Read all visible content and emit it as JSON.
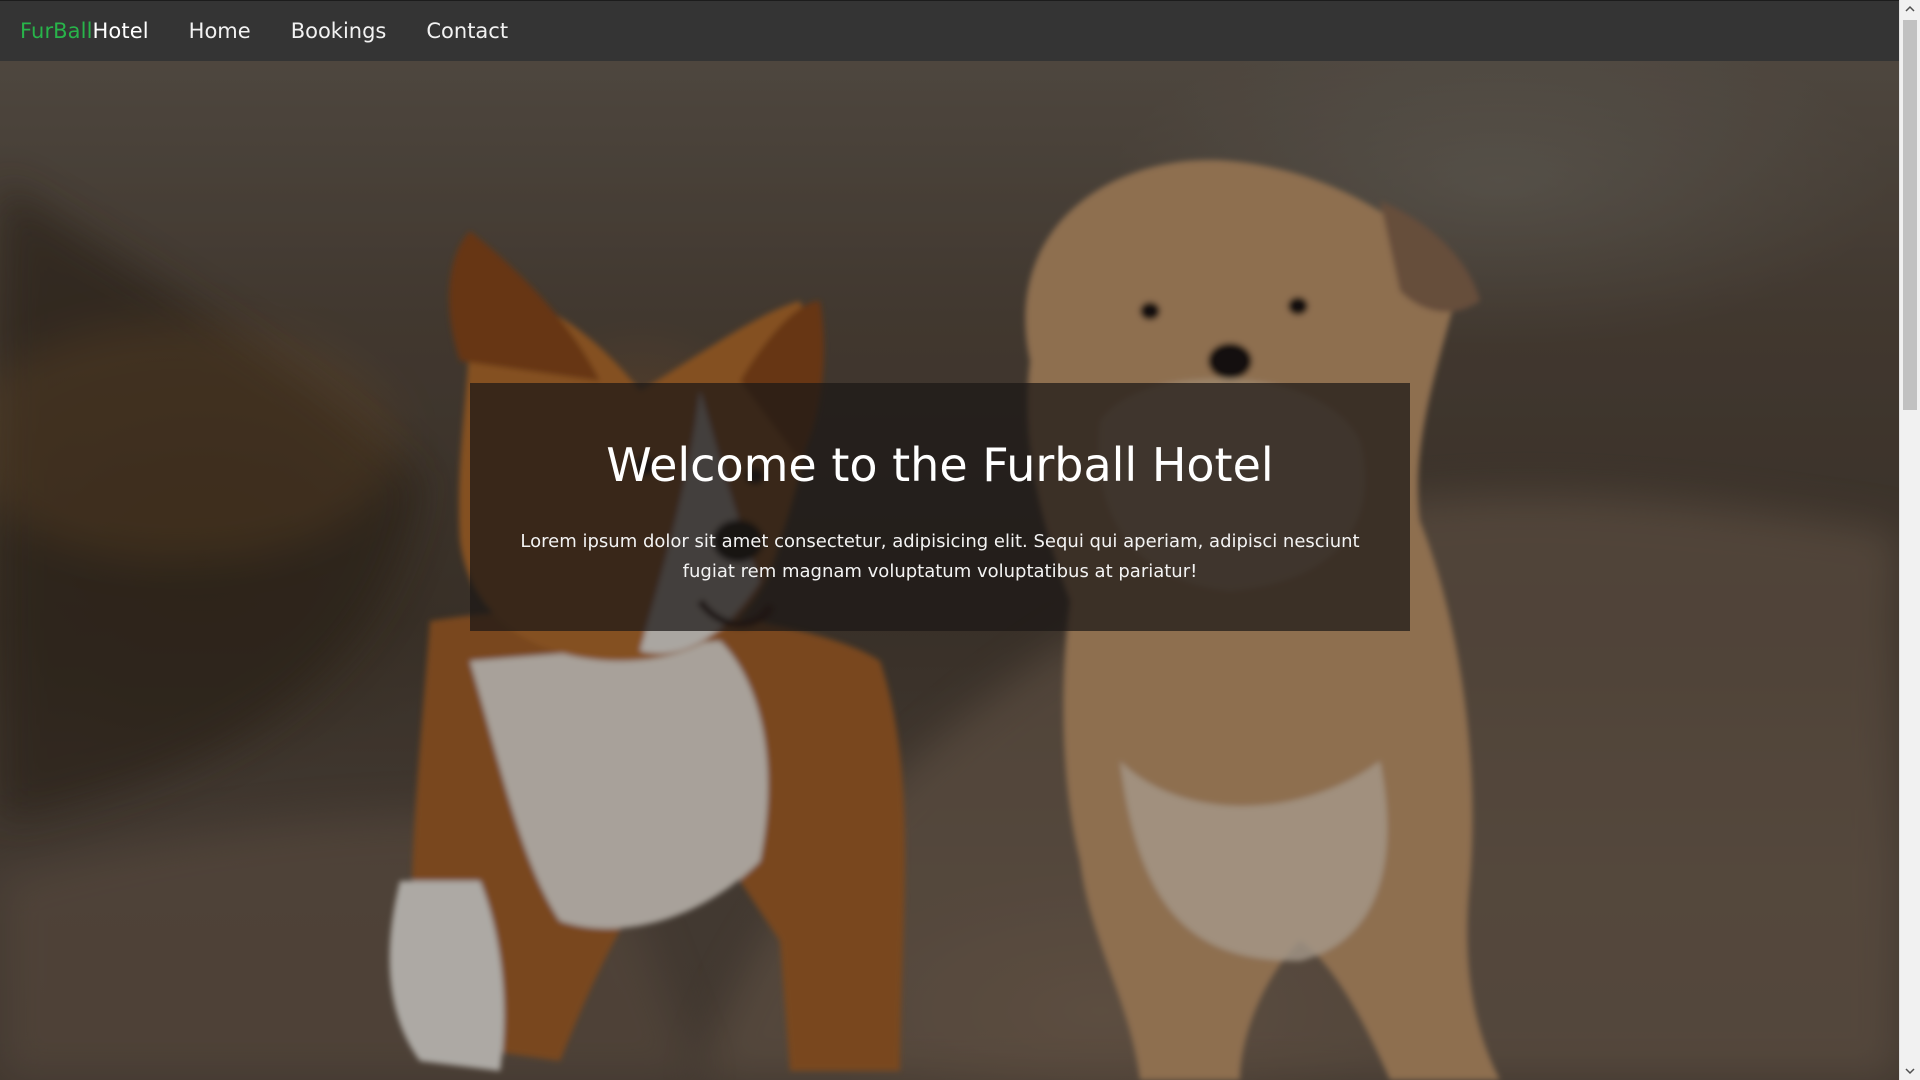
{
  "navbar": {
    "brand": {
      "accent": "FurBall",
      "rest": "Hotel"
    },
    "links": [
      {
        "label": "Home"
      },
      {
        "label": "Bookings"
      },
      {
        "label": "Contact"
      }
    ]
  },
  "hero": {
    "title": "Welcome to the Furball Hotel",
    "text": "Lorem ipsum dolor sit amet consectetur, adipisicing elit. Sequi qui aperiam, adipisci nesciunt fugiat rem magnam voluptatum voluptatibus at pariatur!"
  },
  "colors": {
    "navbar_bg": "#343434",
    "brand_accent": "#28b44a",
    "box_bg": "rgba(28,24,22,0.72)",
    "text": "#ffffff"
  },
  "icons": {
    "scroll_up": "chevron-up-icon",
    "scroll_down": "chevron-down-icon"
  }
}
